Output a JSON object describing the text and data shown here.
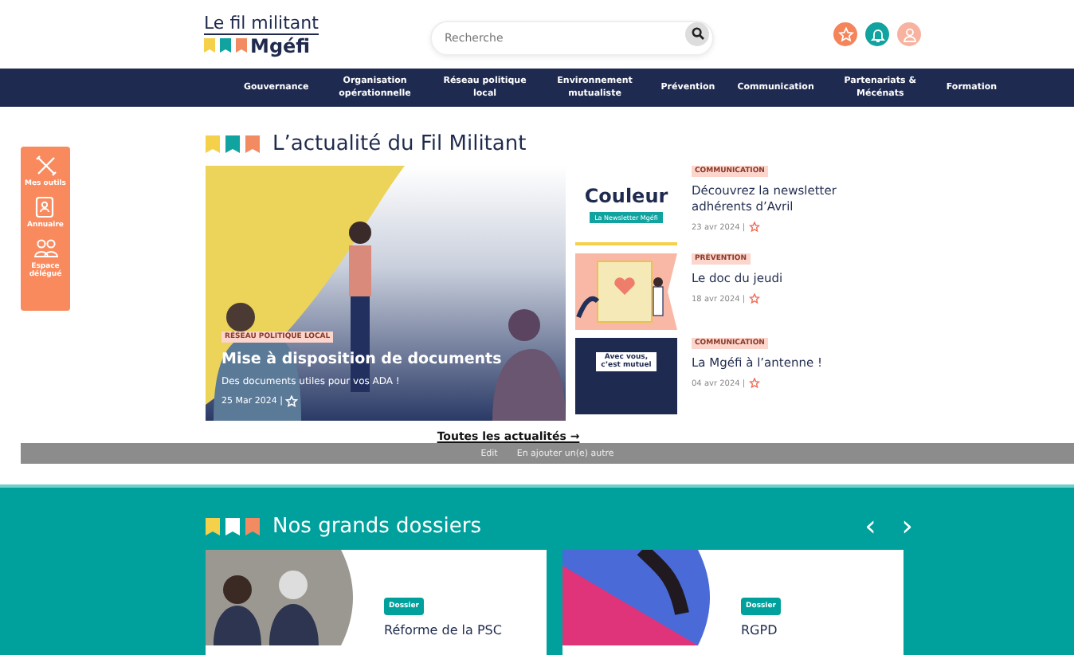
{
  "logo": {
    "line1": "Le fil militant",
    "line2": "Mgéfi"
  },
  "search": {
    "placeholder": "Recherche"
  },
  "nav": [
    "Gouvernance",
    "Organisation opérationnelle",
    "Réseau politique local",
    "Environnement mutualiste",
    "Prévention",
    "Communication",
    "Partenariats & Mécénats",
    "Formation"
  ],
  "tools": [
    {
      "kind": "tools",
      "label": "Mes outils"
    },
    {
      "kind": "directory",
      "label": "Annuaire"
    },
    {
      "kind": "people",
      "label": "Espace délégué"
    }
  ],
  "news": {
    "title": "L’actualité du Fil Militant",
    "featured": {
      "tag": "RÉSEAU POLITIQUE LOCAL",
      "title": "Mise à disposition de documents",
      "text": "Des documents utiles pour vos ADA !",
      "date": "25 Mar 2024 |"
    },
    "items": [
      {
        "tag": "COMMUNICATION",
        "title": "Découvrez la newsletter adhérents d’Avril",
        "date": "23 avr 2024 |",
        "kind": "newsletter",
        "image_text": "Couleur",
        "image_caption": "La Newsletter Mgéfi"
      },
      {
        "tag": "PRÉVENTION",
        "title": "Le doc du jeudi",
        "date": "18 avr 2024 |",
        "kind": "clipboard"
      },
      {
        "tag": "COMMUNICATION",
        "title": "La Mgéfi à l’antenne !",
        "date": "04 avr 2024 |",
        "kind": "radio",
        "image_text": "Avec vous, c’est mutuel"
      }
    ],
    "all_link": "Toutes les actualités →"
  },
  "edit_bar": {
    "edit": "Edit",
    "add": "En ajouter un(e) autre"
  },
  "dossiers": {
    "title": "Nos grands dossiers",
    "prev": "‹",
    "next": "›",
    "items": [
      {
        "tag": "Dossier",
        "title": "Réforme de la PSC",
        "kind": "people"
      },
      {
        "tag": "Dossier",
        "title": "RGPD",
        "kind": "keyboard"
      }
    ]
  }
}
